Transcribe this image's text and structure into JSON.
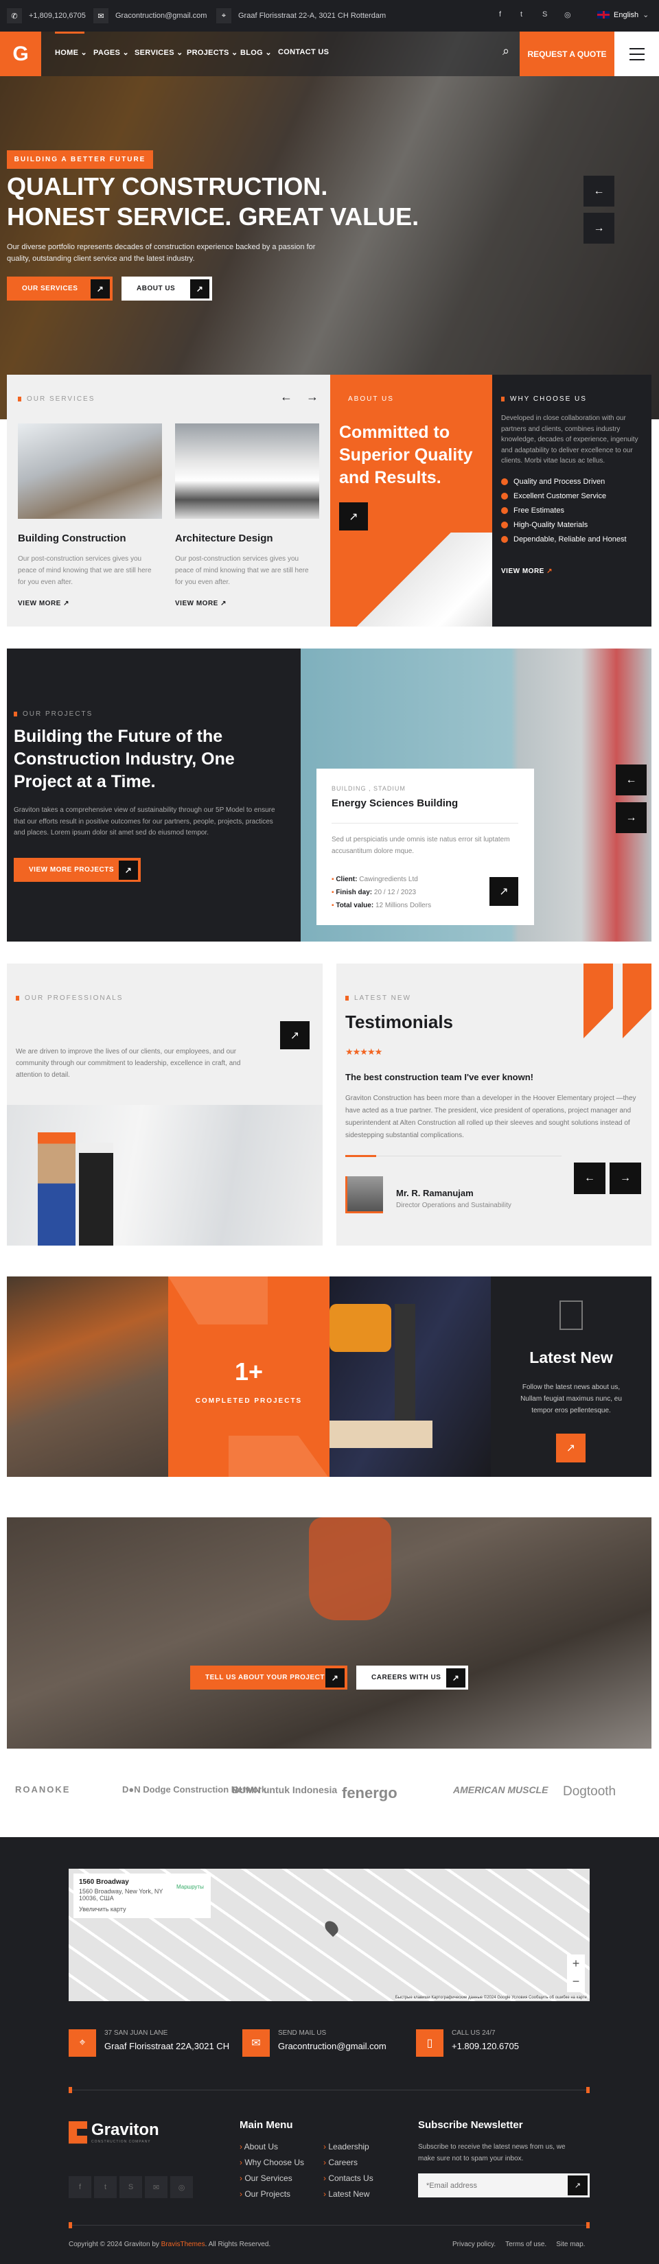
{
  "topbar": {
    "phone": "+1,809,120,6705",
    "email": "Gracontruction@gmail.com",
    "address": "Graaf Florisstraat 22-A, 3021 CH Rotterdam",
    "language": "English",
    "socials": [
      "facebook",
      "twitter",
      "skype",
      "instagram"
    ]
  },
  "nav": {
    "items": [
      "HOME",
      "PAGES",
      "SERVICES",
      "PROJECTS",
      "BLOG",
      "CONTACT US"
    ],
    "active": "HOME",
    "quote": "REQUEST A QUOTE"
  },
  "hero": {
    "badge": "BUILDING A BETTER FUTURE",
    "line1": "QUALITY CONSTRUCTION.",
    "line2": "HONEST SERVICE. GREAT VALUE.",
    "text": "Our diverse portfolio represents decades of construction experience backed by a passion for quality, outstanding client service and the latest industry.",
    "btn1": "OUR SERVICES",
    "btn2": "ABOUT US"
  },
  "services": {
    "label": "OUR SERVICES",
    "cards": [
      {
        "title": "Building Construction",
        "text": "Our post-construction services gives you peace of mind knowing that we are still here for you even after.",
        "link": "VIEW MORE"
      },
      {
        "title": "Architecture Design",
        "text": "Our post-construction services gives you peace of mind knowing that we are still here for you even after.",
        "link": "VIEW MORE"
      }
    ]
  },
  "about": {
    "label": "ABOUT US",
    "title": "Committed to Superior Quality and Results."
  },
  "why": {
    "label": "WHY CHOOSE US",
    "text": "Developed in close collaboration with our partners and clients, combines industry knowledge, decades of experience, ingenuity and adaptability to deliver excellence to our clients. Morbi vitae lacus ac tellus.",
    "items": [
      "Quality and Process Driven",
      "Excellent Customer Service",
      "Free Estimates",
      "High-Quality Materials",
      "Dependable, Reliable and Honest"
    ],
    "link": "VIEW MORE"
  },
  "projects": {
    "label": "OUR PROJECTS",
    "title": "Building the Future of the Construction Industry, One Project at a Time.",
    "text": "Graviton takes a comprehensive view of sustainability through our 5P Model to ensure that our efforts result in positive outcomes for our partners, people, projects, practices and places. Lorem ipsum dolor sit amet sed do eiusmod tempor.",
    "btn": "VIEW MORE PROJECTS",
    "card": {
      "tags": "BUILDING , STADIUM",
      "title": "Energy Sciences Building",
      "text": "Sed ut perspiciatis unde omnis iste natus error sit luptatem accusantitum dolore mque.",
      "client_label": "Client:",
      "client": "Cawingredients Ltd",
      "finish_label": "Finish day:",
      "finish": "20 / 12 / 2023",
      "value_label": "Total value:",
      "value": "12 Millions Dollers"
    }
  },
  "professionals": {
    "label": "OUR PROFESSIONALS",
    "text": "We are driven to improve the lives of our clients, our employees, and our community through our commitment to leadership, excellence in craft, and attention to detail."
  },
  "testimonials": {
    "label": "LATEST NEW",
    "title": "Testimonials",
    "rating": 5,
    "stars": "★★★★★",
    "quote_title": "The best construction team I've ever known!",
    "text": "Graviton Construction has been more than a developer in the Hoover Elementary project —they have acted as a true partner. The president, vice president of operations, project manager and superintendent at Alten Construction all rolled up their sleeves and sought solutions instead of sidestepping substantial complications.",
    "name": "Mr. R. Ramanujam",
    "role": "Director Operations and Sustainability"
  },
  "stats": {
    "value": "1+",
    "label": "COMPLETED PROJECTS"
  },
  "latest": {
    "title": "Latest New",
    "text": "Follow the latest news about us, Nullam feugiat maximus nunc, eu tempor eros pellentesque."
  },
  "cta": {
    "btn1": "TELL US ABOUT YOUR PROJECT",
    "btn2": "CAREERS WITH US"
  },
  "partners": [
    "ROANOKE",
    "D●N Dodge Construction Network",
    "BUMN untuk Indonesia",
    "fenergo",
    "AMERICAN MUSCLE",
    "Dogtooth"
  ],
  "map": {
    "place": "1560 Broadway",
    "address": "1560 Broadway, New York, NY 10036, США",
    "enlarge": "Увеличить карту",
    "directions": "Маршруты",
    "attribution": "Быстрые клавиши  Картографические данные ©2024 Google  Условия  Сообщить об ошибке на карте"
  },
  "contact": [
    {
      "label": "37 SAN JUAN LANE",
      "value": "Graaf Florisstraat 22A,3021 CH"
    },
    {
      "label": "SEND MAIL US",
      "value": "Gracontruction@gmail.com"
    },
    {
      "label": "CALL US 24/7",
      "value": "+1.809.120.6705"
    }
  ],
  "footer": {
    "brand": "Graviton",
    "tagline": "CONSTRUCTION COMPANY",
    "menu_title": "Main Menu",
    "menu": [
      "About Us",
      "Why Choose Us",
      "Our Services",
      "Our Projects",
      "Leadership",
      "Careers",
      "Contacts Us",
      "Latest New"
    ],
    "newsletter_title": "Subscribe Newsletter",
    "newsletter_text": "Subscribe to receive the latest news from us, we make sure not to spam your inbox.",
    "email_placeholder": "*Email address",
    "copyright_pre": "Copyright © 2024 Graviton by ",
    "copyright_link": "BravisThemes",
    "copyright_post": ". All Rights Reserved.",
    "links": [
      "Privacy policy.",
      "Terms of use.",
      "Site map."
    ]
  },
  "colors": {
    "accent": "#f26522",
    "dark": "#1e1f23",
    "light": "#f0f0f0"
  }
}
